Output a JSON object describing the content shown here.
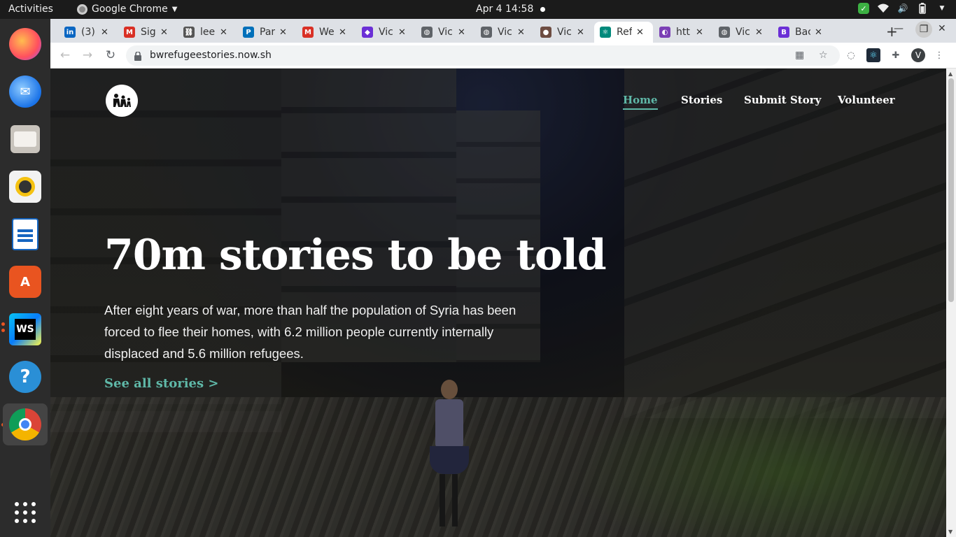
{
  "topbar": {
    "activities": "Activities",
    "app_name": "Google Chrome",
    "clock": "Apr 4  14:58"
  },
  "dock": {
    "items": [
      "Firefox",
      "Thunderbird",
      "Files",
      "Rhythmbox",
      "LibreOffice Writer",
      "Ubuntu Software",
      "WebStorm",
      "Help",
      "Google Chrome",
      "Show Applications"
    ]
  },
  "tabs": [
    {
      "title": "(3)",
      "icon": "linkedin-icon",
      "color": "#0a66c2"
    },
    {
      "title": "Sig",
      "icon": "gmail-icon",
      "color": "#d93025"
    },
    {
      "title": "lee",
      "icon": "link-icon",
      "color": "#555555"
    },
    {
      "title": "Par",
      "icon": "paypal-icon",
      "color": "#0070ba"
    },
    {
      "title": "We",
      "icon": "gmail-icon",
      "color": "#d93025"
    },
    {
      "title": "Vic",
      "icon": "graphql-icon",
      "color": "#6b2fd6"
    },
    {
      "title": "Vic",
      "icon": "globe-icon",
      "color": "#5f6368"
    },
    {
      "title": "Vic",
      "icon": "globe-icon",
      "color": "#5f6368"
    },
    {
      "title": "Vic",
      "icon": "avatar-icon",
      "color": "#6d4c41"
    },
    {
      "title": "Ref",
      "icon": "react-icon",
      "color": "#00897b"
    },
    {
      "title": "htt",
      "icon": "loading-icon",
      "color": "#7b3fb5"
    },
    {
      "title": "Vic",
      "icon": "globe-icon",
      "color": "#5f6368"
    },
    {
      "title": "Bac",
      "icon": "apollo-icon",
      "color": "#6b2fd6"
    }
  ],
  "toolbar": {
    "url": "bwrefugeestories.now.sh",
    "profile_initial": "V"
  },
  "site": {
    "nav": {
      "home": "Home",
      "stories": "Stories",
      "submit": "Submit Story",
      "volunteer": "Volunteer"
    },
    "hero_title": "70m stories to be told",
    "hero_text": "After eight years of war, more than half the population of Syria has been forced to flee their homes, with 6.2 million people currently internally displaced and 5.6 million refugees.",
    "hero_link": "See all stories >"
  },
  "colors": {
    "accent": "#5fb8a8",
    "chrome_tabstrip": "#dee1e6",
    "dock": "#2c2c2c"
  }
}
